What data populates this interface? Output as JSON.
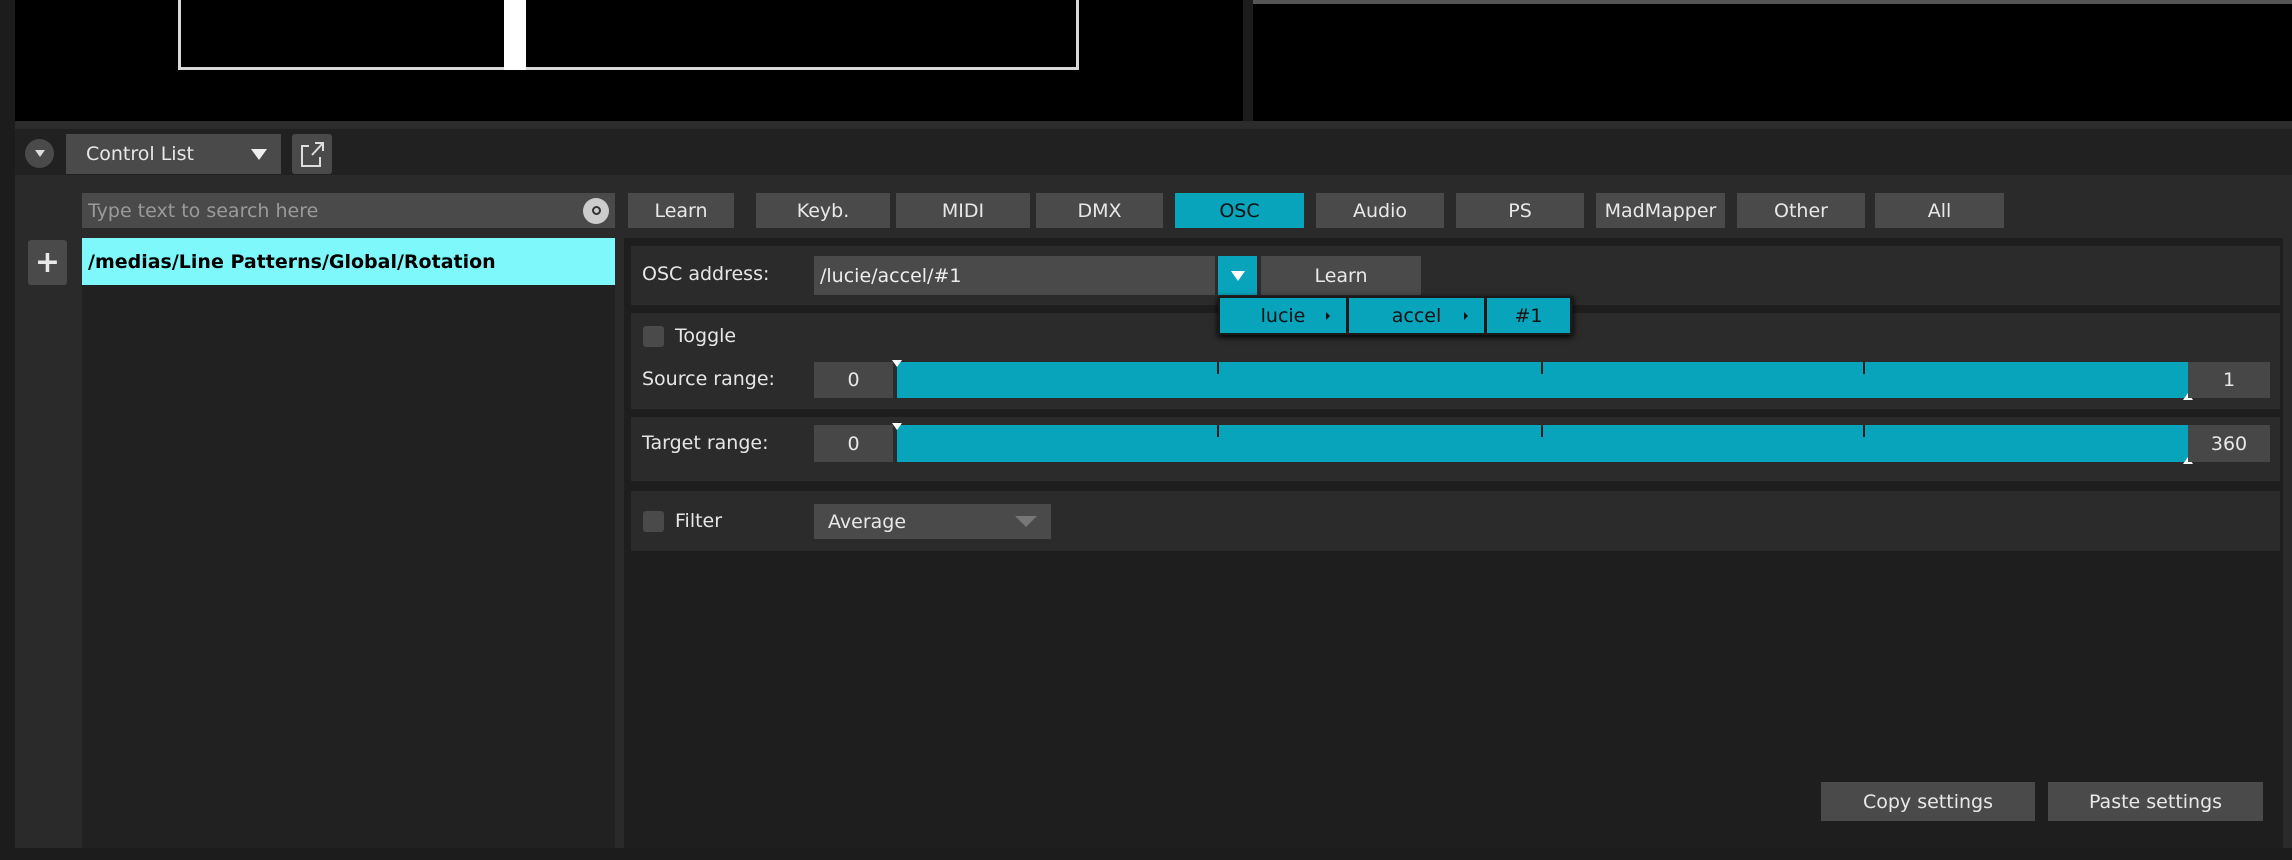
{
  "toolbar": {
    "view_select": "Control List"
  },
  "search": {
    "placeholder": "Type text to search here"
  },
  "filters": [
    {
      "label": "Learn",
      "active": false
    },
    {
      "label": "Keyb.",
      "active": false
    },
    {
      "label": "MIDI",
      "active": false
    },
    {
      "label": "DMX",
      "active": false
    },
    {
      "label": "OSC",
      "active": true
    },
    {
      "label": "Audio",
      "active": false
    },
    {
      "label": "PS",
      "active": false
    },
    {
      "label": "MadMapper",
      "active": false
    },
    {
      "label": "Other",
      "active": false
    },
    {
      "label": "All",
      "active": false
    }
  ],
  "controls": [
    {
      "label": "/medias/Line Patterns/Global/Rotation",
      "selected": true
    }
  ],
  "detail": {
    "osc_label": "OSC address:",
    "osc_value": "/lucie/accel/#1",
    "learn_label": "Learn",
    "menu": [
      {
        "label": "lucie",
        "submenu": true
      },
      {
        "label": "accel",
        "submenu": true
      },
      {
        "label": "#1",
        "submenu": false
      }
    ],
    "toggle_label": "Toggle",
    "toggle_checked": false,
    "source_label": "Source range:",
    "source_min": "0",
    "source_max": "1",
    "target_label": "Target range:",
    "target_min": "0",
    "target_max": "360",
    "filter_label": "Filter",
    "filter_checked": false,
    "filter_value": "Average",
    "copy_label": "Copy settings",
    "paste_label": "Paste settings"
  },
  "colors": {
    "accent": "#07a4bb",
    "selection": "#7ff8fc"
  }
}
